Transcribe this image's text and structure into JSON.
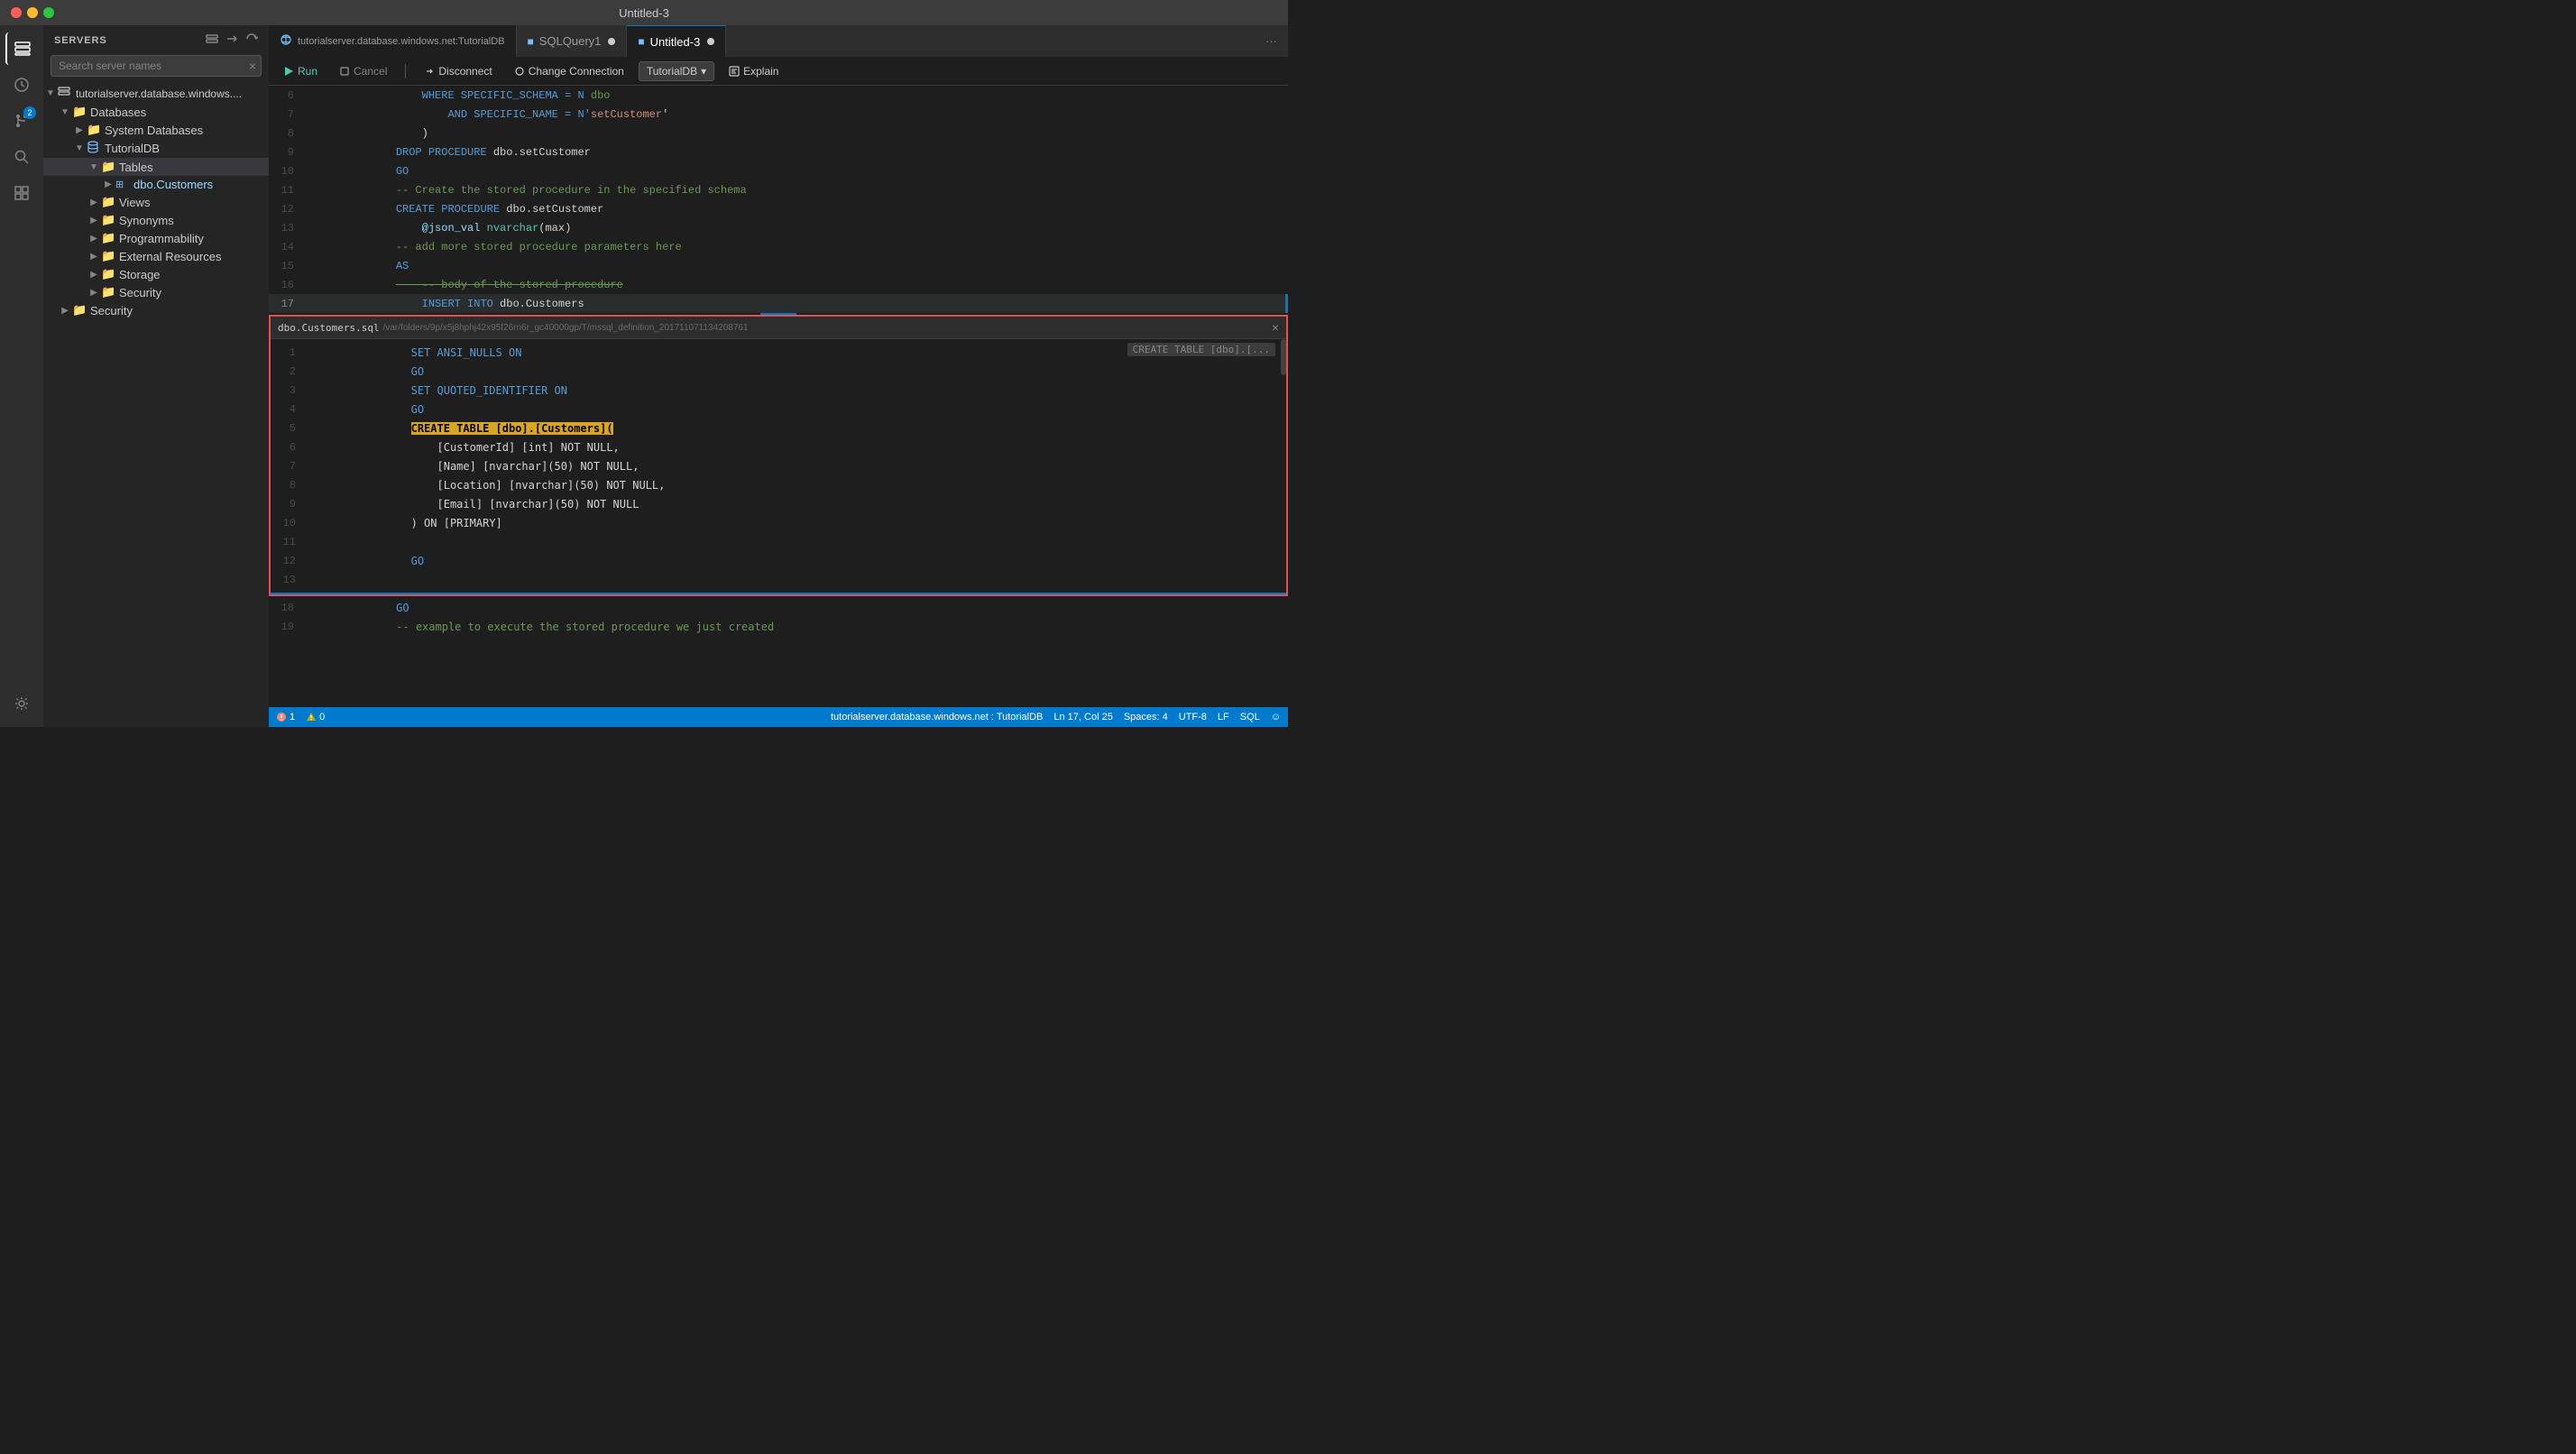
{
  "titlebar": {
    "title": "Untitled-3"
  },
  "activity": {
    "icons": [
      {
        "name": "servers-icon",
        "symbol": "⬜",
        "active": true
      },
      {
        "name": "history-icon",
        "symbol": "🕐",
        "active": false
      },
      {
        "name": "git-icon",
        "symbol": "⑂",
        "active": false
      },
      {
        "name": "badge-number",
        "value": "2"
      },
      {
        "name": "search-icon",
        "symbol": "🔍",
        "active": false
      },
      {
        "name": "extension-icon",
        "symbol": "✦",
        "active": false
      }
    ],
    "bottom_icon": {
      "name": "settings-icon",
      "symbol": "⚙"
    }
  },
  "sidebar": {
    "header": "SERVERS",
    "search_placeholder": "Search server names",
    "tree": [
      {
        "id": "server",
        "label": "tutorialserver.database.windows....",
        "indent": 0,
        "arrow": "▼",
        "icon": "server",
        "expanded": true
      },
      {
        "id": "databases",
        "label": "Databases",
        "indent": 1,
        "arrow": "▼",
        "icon": "folder",
        "expanded": true
      },
      {
        "id": "system-dbs",
        "label": "System Databases",
        "indent": 2,
        "arrow": "▶",
        "icon": "folder",
        "expanded": false
      },
      {
        "id": "tutorialdb",
        "label": "TutorialDB",
        "indent": 2,
        "arrow": "▼",
        "icon": "database",
        "expanded": true
      },
      {
        "id": "tables",
        "label": "Tables",
        "indent": 3,
        "arrow": "▼",
        "icon": "folder",
        "expanded": true,
        "selected": true
      },
      {
        "id": "customers",
        "label": "dbo.Customers",
        "indent": 4,
        "arrow": "▶",
        "icon": "table",
        "expanded": false
      },
      {
        "id": "views",
        "label": "Views",
        "indent": 3,
        "arrow": "▶",
        "icon": "folder",
        "expanded": false
      },
      {
        "id": "synonyms",
        "label": "Synonyms",
        "indent": 3,
        "arrow": "▶",
        "icon": "folder",
        "expanded": false
      },
      {
        "id": "programmability",
        "label": "Programmability",
        "indent": 3,
        "arrow": "▶",
        "icon": "folder",
        "expanded": false
      },
      {
        "id": "external-resources",
        "label": "External Resources",
        "indent": 3,
        "arrow": "▶",
        "icon": "folder",
        "expanded": false
      },
      {
        "id": "storage",
        "label": "Storage",
        "indent": 3,
        "arrow": "▶",
        "icon": "folder",
        "expanded": false
      },
      {
        "id": "security1",
        "label": "Security",
        "indent": 3,
        "arrow": "▶",
        "icon": "folder",
        "expanded": false
      },
      {
        "id": "security2",
        "label": "Security",
        "indent": 1,
        "arrow": "▶",
        "icon": "folder",
        "expanded": false
      }
    ]
  },
  "tabs": {
    "connection": "tutorialserver.database.windows.net:TutorialDB",
    "items": [
      {
        "label": "SQLQuery1",
        "active": false,
        "dot": true,
        "icon": "sql"
      },
      {
        "label": "Untitled-3",
        "active": true,
        "dot": true,
        "icon": "sql"
      }
    ]
  },
  "toolbar": {
    "run_label": "Run",
    "cancel_label": "Cancel",
    "disconnect_label": "Disconnect",
    "change_connection_label": "Change Connection",
    "db_name": "TutorialDB",
    "explain_label": "Explain"
  },
  "editor": {
    "upper_lines": [
      {
        "num": "6",
        "tokens": [
          {
            "text": "    WHERE SPECIFIC_SCHEMA = N ",
            "cls": "kw"
          },
          {
            "text": "dbo",
            "cls": "str"
          },
          {
            "text": " ",
            "cls": "text-plain"
          }
        ]
      },
      {
        "num": "7",
        "tokens": [
          {
            "text": "        AND SPECIFIC_NAME = N'",
            "cls": "kw"
          },
          {
            "text": "setCustomer",
            "cls": "str"
          },
          {
            "text": "'",
            "cls": "text-plain"
          }
        ]
      },
      {
        "num": "8",
        "tokens": [
          {
            "text": "    )",
            "cls": "text-plain"
          }
        ]
      },
      {
        "num": "9",
        "tokens": [
          {
            "text": "DROP PROCEDURE ",
            "cls": "kw"
          },
          {
            "text": "dbo.setCustomer",
            "cls": "text-plain"
          }
        ]
      },
      {
        "num": "10",
        "tokens": [
          {
            "text": "GO",
            "cls": "kw"
          }
        ]
      },
      {
        "num": "11",
        "tokens": [
          {
            "text": "-- Create the stored procedure in the specified schema",
            "cls": "comment"
          }
        ]
      },
      {
        "num": "12",
        "tokens": [
          {
            "text": "CREATE ",
            "cls": "kw"
          },
          {
            "text": "PROCEDURE ",
            "cls": "kw"
          },
          {
            "text": "dbo.setCustomer",
            "cls": "text-plain"
          }
        ]
      },
      {
        "num": "13",
        "tokens": [
          {
            "text": "    @json_val ",
            "cls": "name"
          },
          {
            "text": "nvarchar",
            "cls": "type"
          },
          {
            "text": "(max)",
            "cls": "text-plain"
          }
        ]
      },
      {
        "num": "14",
        "tokens": [
          {
            "text": "-- add more stored procedure parameters here",
            "cls": "comment"
          }
        ]
      },
      {
        "num": "15",
        "tokens": [
          {
            "text": "AS",
            "cls": "kw"
          }
        ]
      },
      {
        "num": "16",
        "tokens": [
          {
            "text": "    -- body of the stored procedure",
            "cls": "comment"
          },
          {
            "text": "",
            "cls": "strikethrough"
          }
        ]
      },
      {
        "num": "17",
        "tokens": [
          {
            "text": "    INSERT INTO ",
            "cls": "kw"
          },
          {
            "text": "dbo.Customers",
            "cls": "text-plain"
          }
        ]
      }
    ],
    "inline_panel": {
      "filename": "dbo.Customers.sql",
      "filepath": "/var/folders/9p/x5j8hphj42x95f26rn6r_gc40000gp/T/mssql_definition_201711071134208761",
      "suggestion": "CREATE TABLE [dbo].[...",
      "lines": [
        {
          "num": "1",
          "tokens": [
            {
              "text": "SET ANSI_NULLS ON",
              "cls": "kw"
            }
          ]
        },
        {
          "num": "2",
          "tokens": [
            {
              "text": "GO",
              "cls": "kw"
            }
          ]
        },
        {
          "num": "3",
          "tokens": [
            {
              "text": "SET QUOTED_IDENTIFIER ON",
              "cls": "kw"
            }
          ]
        },
        {
          "num": "4",
          "tokens": [
            {
              "text": "GO",
              "cls": "kw"
            }
          ]
        },
        {
          "num": "5",
          "tokens": [
            {
              "text": "CREATE TABLE ",
              "cls": "kw highlight-yellow"
            },
            {
              "text": "[dbo].[Customers](",
              "cls": "highlight-yellow"
            }
          ]
        },
        {
          "num": "6",
          "tokens": [
            {
              "text": "    [CustomerId] [int] NOT NULL,",
              "cls": "text-plain"
            }
          ]
        },
        {
          "num": "7",
          "tokens": [
            {
              "text": "    [Name] [nvarchar](50) NOT NULL,",
              "cls": "text-plain"
            }
          ]
        },
        {
          "num": "8",
          "tokens": [
            {
              "text": "    [Location] [nvarchar](50) NOT NULL,",
              "cls": "text-plain"
            }
          ]
        },
        {
          "num": "9",
          "tokens": [
            {
              "text": "    [Email] [nvarchar](50) NOT NULL",
              "cls": "text-plain"
            }
          ]
        },
        {
          "num": "10",
          "tokens": [
            {
              "text": ") ON [PRIMARY]",
              "cls": "text-plain"
            }
          ]
        },
        {
          "num": "11",
          "tokens": []
        },
        {
          "num": "12",
          "tokens": [
            {
              "text": "GO",
              "cls": "kw"
            }
          ]
        },
        {
          "num": "13",
          "tokens": []
        }
      ]
    },
    "lower_lines": [
      {
        "num": "18",
        "tokens": [
          {
            "text": "GO",
            "cls": "kw"
          }
        ]
      },
      {
        "num": "19",
        "tokens": [
          {
            "text": "-- example to execute the stored procedure we just created",
            "cls": "comment"
          }
        ]
      }
    ]
  },
  "status_bar": {
    "errors": "⊗ 1",
    "warnings": "⚠ 0",
    "connection": "tutorialserver.database.windows.net : TutorialDB",
    "cursor": "Ln 17, Col 25",
    "spaces": "Spaces: 4",
    "encoding": "UTF-8",
    "line_ending": "LF",
    "language": "SQL",
    "smiley": "☺"
  }
}
